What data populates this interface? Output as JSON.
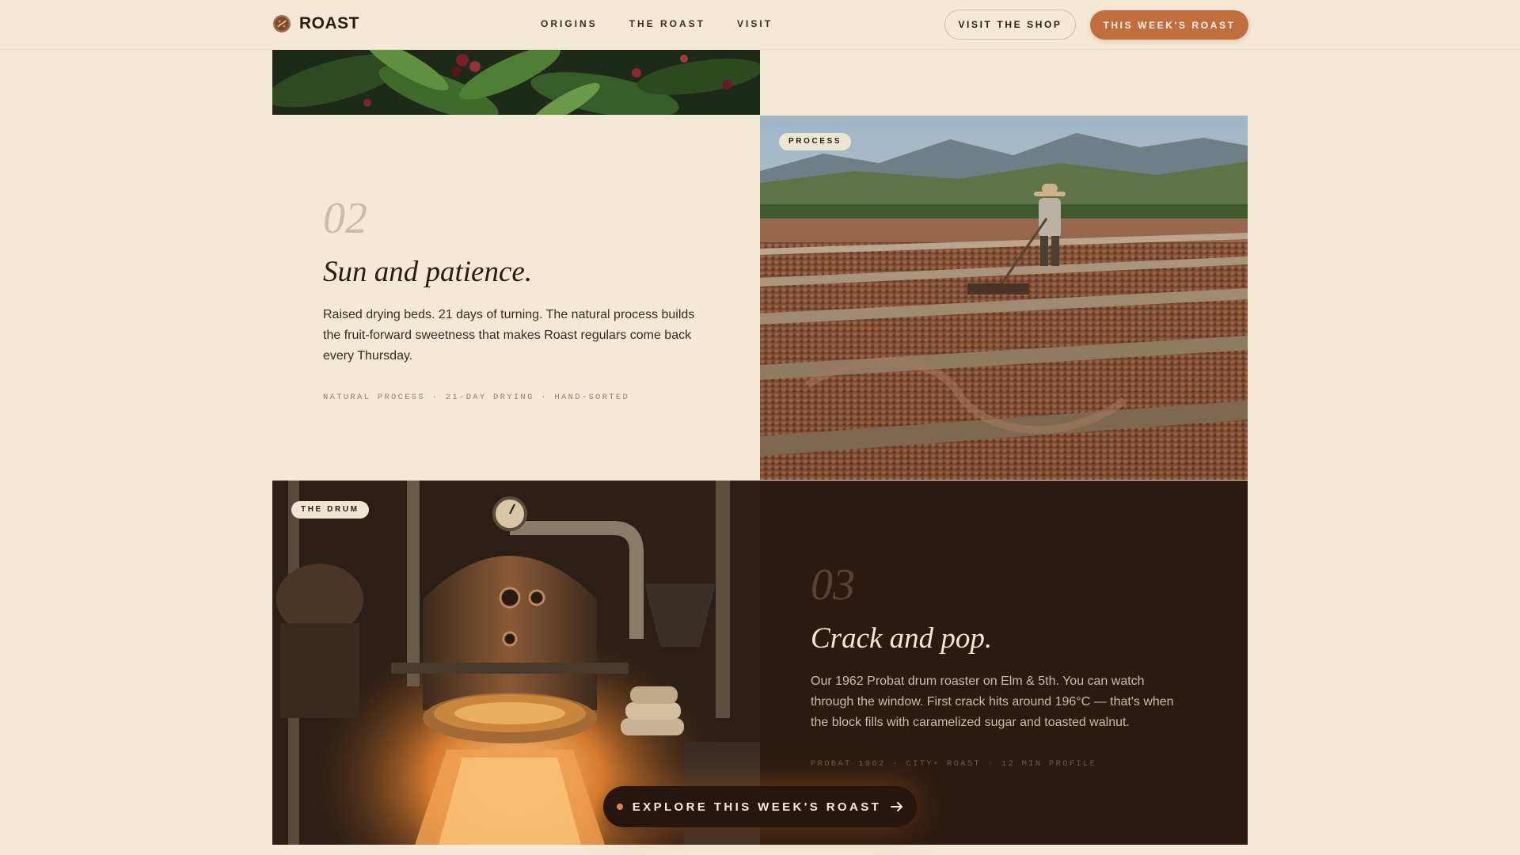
{
  "header": {
    "brand": "ROAST",
    "nav": [
      "ORIGINS",
      "THE ROAST",
      "VISIT"
    ],
    "shop_button": "VISIT THE SHOP",
    "primary_button": "THIS WEEK'S ROAST"
  },
  "sections": {
    "process": {
      "tag": "PROCESS",
      "number": "02",
      "title": "Sun and patience.",
      "body": "Raised drying beds. 21 days of turning. The natural process builds the fruit-forward sweetness that makes Roast regulars come back every Thursday.",
      "meta": "NATURAL PROCESS · 21-DAY DRYING · HAND-SORTED"
    },
    "drum": {
      "tag": "THE DRUM",
      "number": "03",
      "title": "Crack and pop.",
      "body": "Our 1962 Probat drum roaster on Elm & 5th. You can watch through the window. First crack hits around 196°C — that's when the block fills with caramelized sugar and toasted walnut.",
      "meta": "PROBAT 1962 · CITY+ ROAST · 12 MIN PROFILE"
    }
  },
  "cta": {
    "label": "EXPLORE THIS WEEK'S ROAST"
  },
  "colors": {
    "background": "#f4e9d6",
    "accent": "#c06d3f",
    "dark_panel": "#2c1a10"
  },
  "icons": {
    "brand": "coffee-bean-logo-icon",
    "cta_dot": "dot-icon",
    "cta_arrow": "arrow-right-icon"
  }
}
